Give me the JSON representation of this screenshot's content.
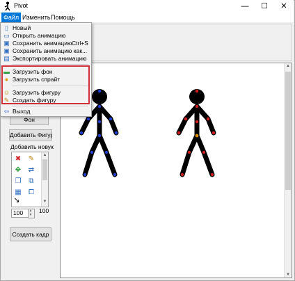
{
  "window": {
    "title": "Pivot",
    "minimize": "—",
    "maximize": "☐",
    "close": "✕"
  },
  "menubar": {
    "file": "Файл",
    "edit": "Изменить",
    "help": "Помощь"
  },
  "file_menu": {
    "items": [
      {
        "label": "Новый",
        "icon": "new-file-icon"
      },
      {
        "label": "Открыть анимацию",
        "icon": "open-icon"
      },
      {
        "label": "Сохранить анимацию",
        "shortcut": "Ctrl+S",
        "icon": "save-icon"
      },
      {
        "label": "Сохранить анимацию как...",
        "icon": "save-as-icon"
      },
      {
        "label": "Экспортировать анимацию",
        "icon": "export-icon"
      },
      {
        "label": "Загрузить фон",
        "icon": "background-icon"
      },
      {
        "label": "Загрузить спрайт",
        "icon": "sprite-icon"
      },
      {
        "label": "Загрузить фигуру",
        "icon": "load-figure-icon"
      },
      {
        "label": "Создать фигуру",
        "icon": "create-figure-icon"
      },
      {
        "label": "Выход",
        "icon": "exit-icon"
      }
    ],
    "highlight_color": "#d0303a"
  },
  "left_panel": {
    "background_button": "Фон",
    "add_figure_button": "Добавить Фигур",
    "add_new_label": "Добавить новую ф",
    "size_value": "100",
    "size_label": "100",
    "create_frame_button": "Создать кадр"
  },
  "figures": {
    "left_joint_color": "#1f3fd0",
    "right_joint_color": "#d02020",
    "center_joint_color": "#e08a00",
    "body_color": "#000000"
  }
}
